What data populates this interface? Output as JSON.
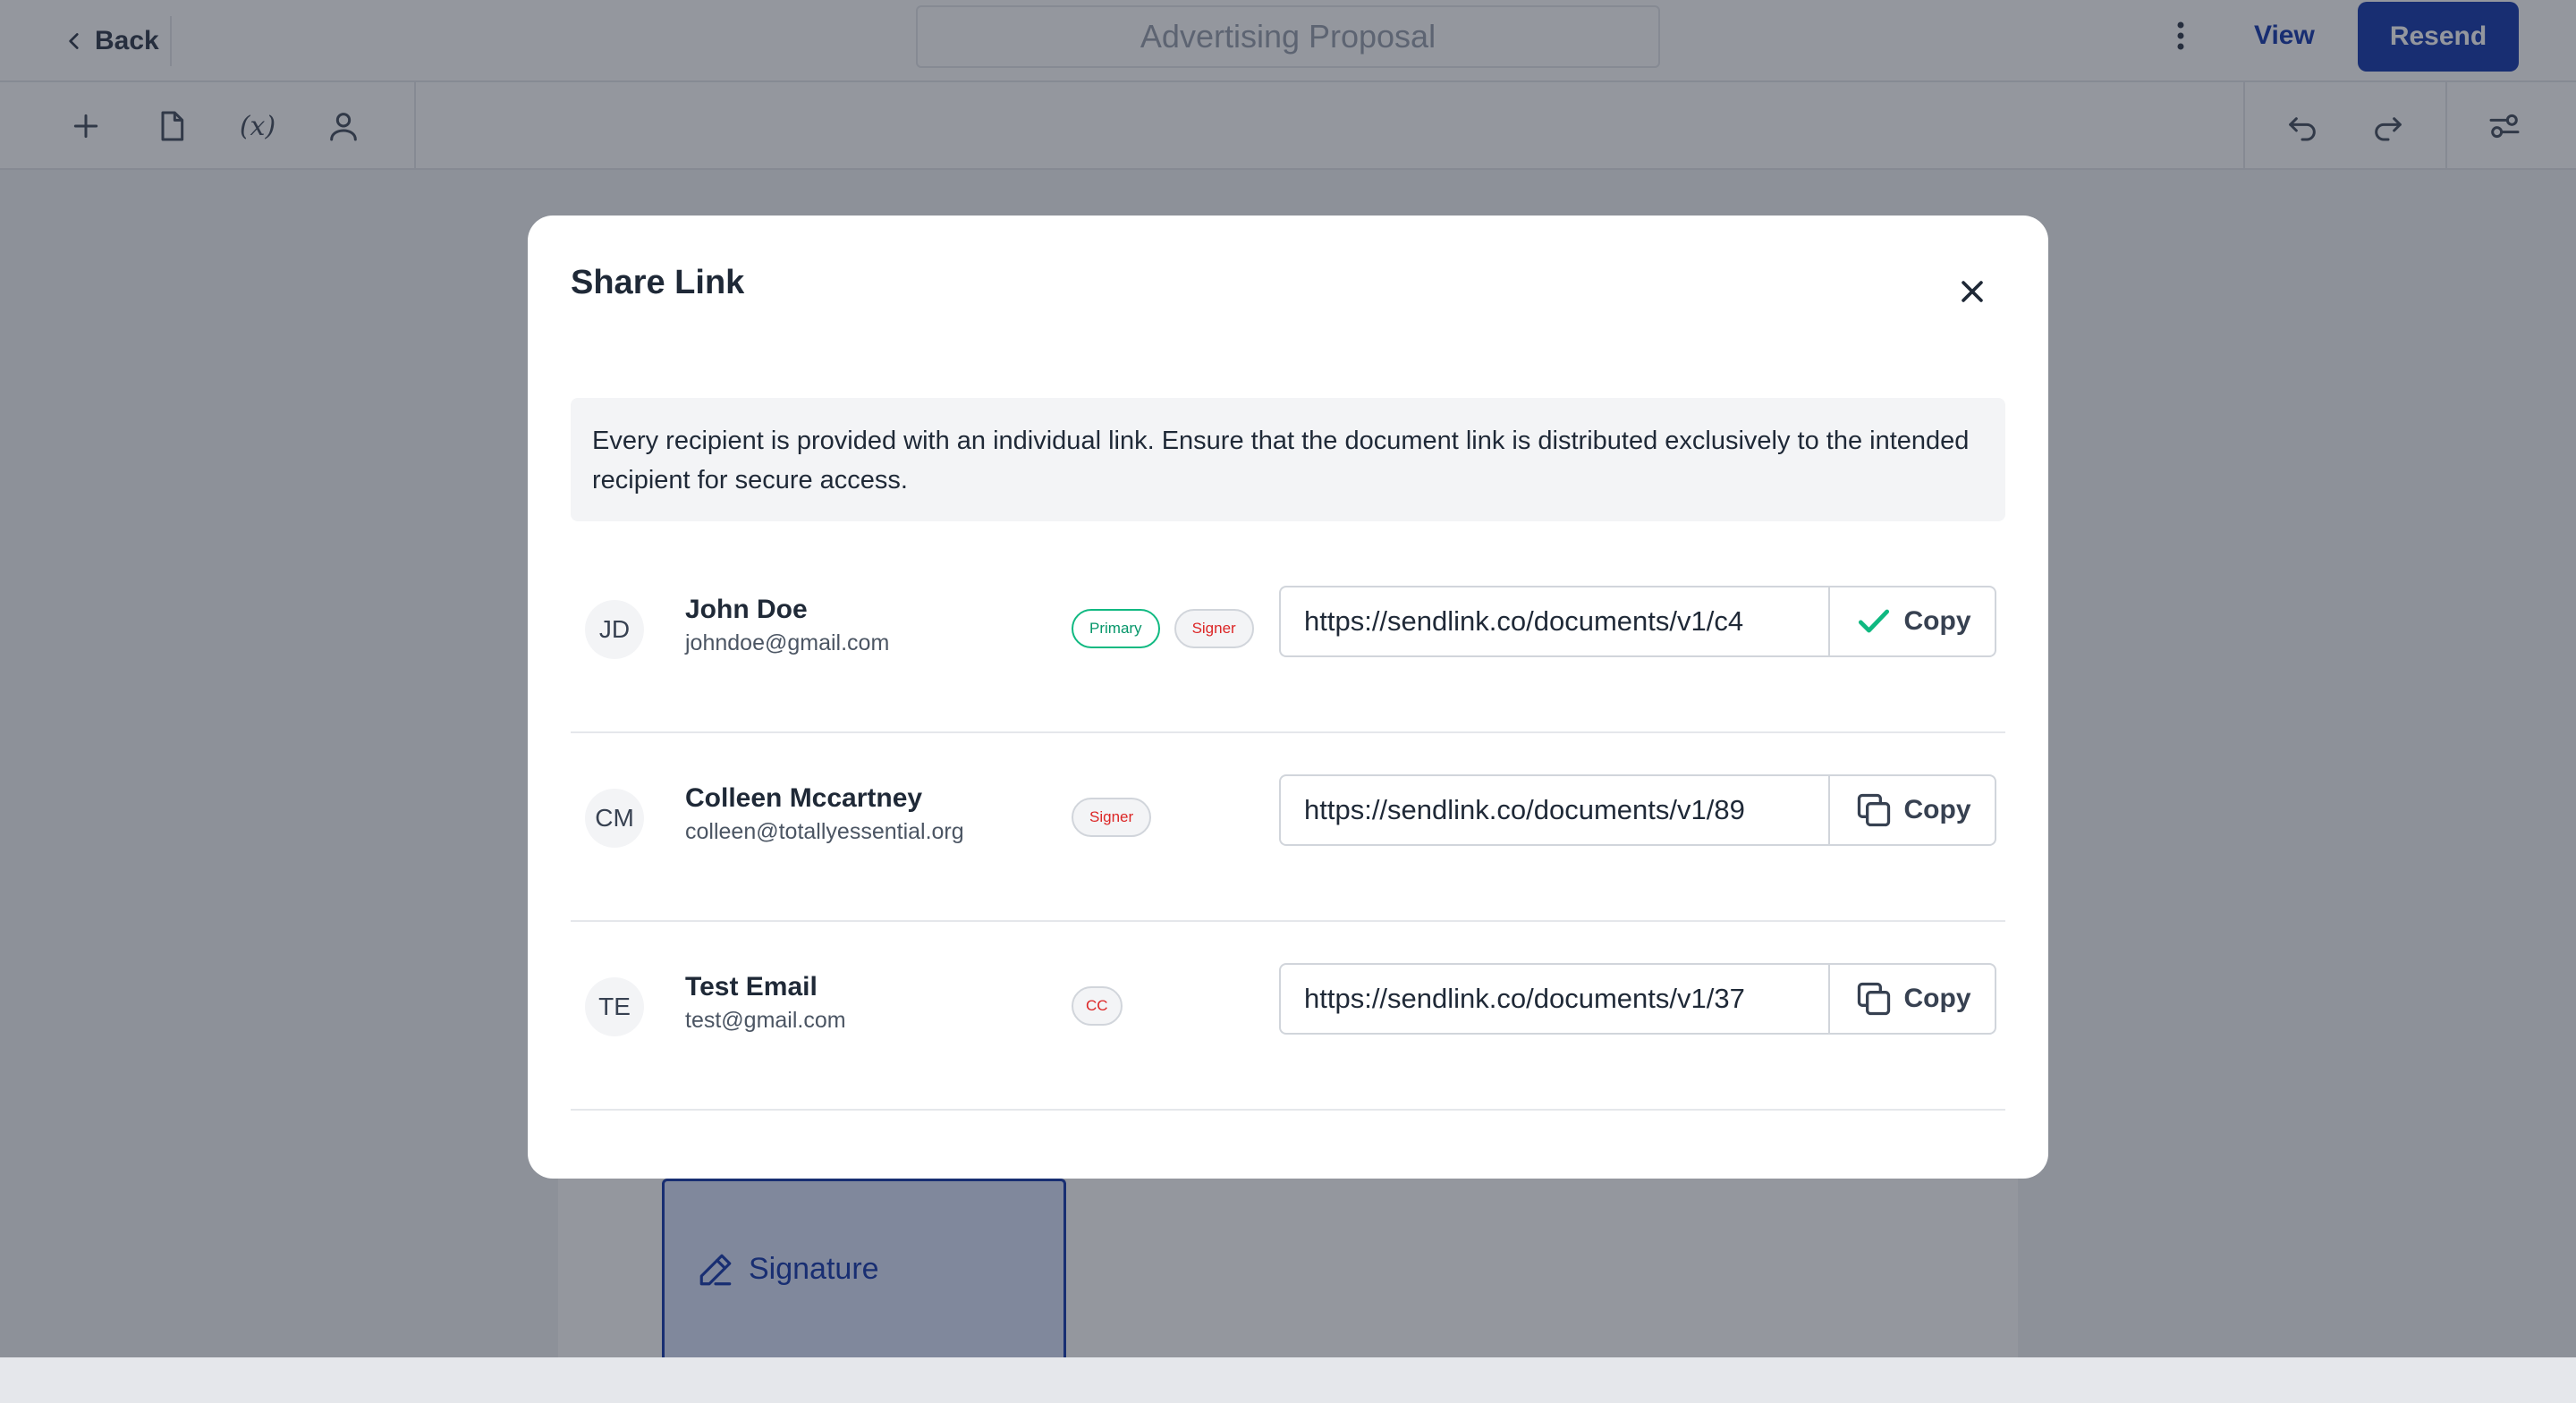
{
  "header": {
    "back_label": "Back",
    "doc_title": "Advertising Proposal",
    "view_label": "View",
    "resend_label": "Resend"
  },
  "toolbar": {
    "variable_label": "(x)"
  },
  "canvas": {
    "signature_label": "Signature"
  },
  "modal": {
    "title": "Share Link",
    "notice": "Every recipient is provided with an individual link. Ensure that the document link is distributed exclusively to the intended recipient for secure access.",
    "recipients": [
      {
        "initials": "JD",
        "name": "John Doe",
        "email": "johndoe@gmail.com",
        "badges": [
          "Primary",
          "Signer"
        ],
        "link": "https://sendlink.co/documents/v1/c4",
        "copy_label": "Copy",
        "copied": true
      },
      {
        "initials": "CM",
        "name": "Colleen Mccartney",
        "email": "colleen@totallyessential.org",
        "badges": [
          "Signer"
        ],
        "link": "https://sendlink.co/documents/v1/89",
        "copy_label": "Copy",
        "copied": false
      },
      {
        "initials": "TE",
        "name": "Test Email",
        "email": "test@gmail.com",
        "badges": [
          "CC"
        ],
        "link": "https://sendlink.co/documents/v1/37",
        "copy_label": "Copy",
        "copied": false
      }
    ]
  },
  "colors": {
    "brand": "#1e40af",
    "success": "#10b981",
    "signer": "#dc2626"
  }
}
